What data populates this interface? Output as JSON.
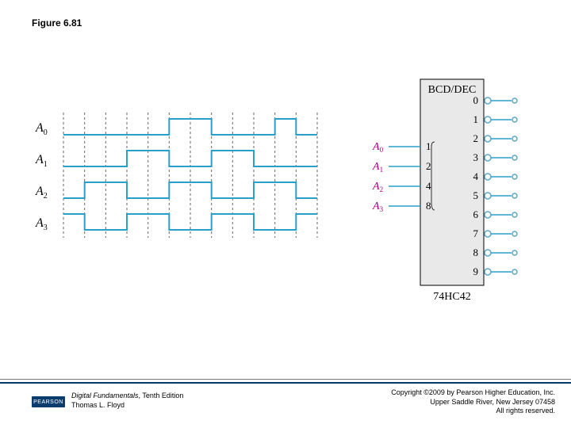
{
  "figure_title": "Figure 6.81",
  "timing": {
    "signals": [
      "A",
      "A",
      "A",
      "A"
    ],
    "subs": [
      "0",
      "1",
      "2",
      "3"
    ]
  },
  "decoder": {
    "title": "BCD/DEC",
    "part": "74HC42",
    "inputs": {
      "labels": [
        "A",
        "A",
        "A",
        "A"
      ],
      "subs": [
        "0",
        "1",
        "2",
        "3"
      ],
      "weights": [
        "1",
        "2",
        "4",
        "8"
      ]
    },
    "outputs": [
      "0",
      "1",
      "2",
      "3",
      "4",
      "5",
      "6",
      "7",
      "8",
      "9"
    ]
  },
  "footer": {
    "book": "Digital Fundamentals",
    "edition": ", Tenth Edition",
    "author": "Thomas L. Floyd",
    "copyright": "Copyright ©2009 by Pearson Higher Education, Inc.",
    "address": "Upper Saddle River, New Jersey 07458",
    "rights": "All rights reserved."
  },
  "logo": "PEARSON"
}
